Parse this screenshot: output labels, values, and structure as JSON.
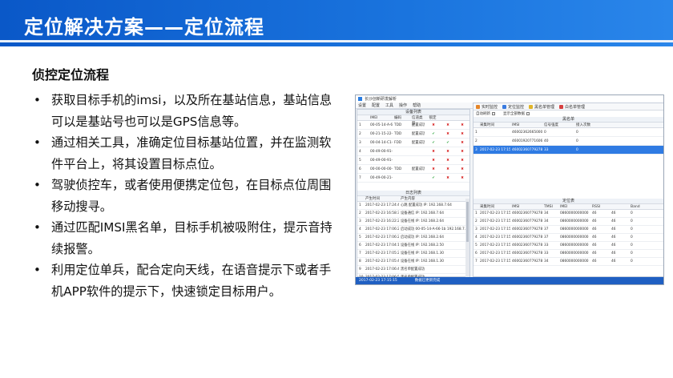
{
  "slide": {
    "title": "定位解决方案——定位流程",
    "heading": "侦控定位流程",
    "bullets": [
      "获取目标手机的imsi，以及所在基站信息，基站信息可以是基站号也可以是GPS信息等。",
      "通过相关工具，准确定位目标基站位置，并在监测软件平台上，将其设置目标点位。",
      "驾驶侦控车，或者使用便携定位包，在目标点位周围移动搜寻。",
      "通过匹配IMSI黑名单，目标手机被吸附住，提示音持续报警。",
      "利用定位单兵，配合定向天线，在语音提示下或者手机APP软件的提示下，快速锁定目标用户。"
    ],
    "bullet_symbol": "•"
  },
  "screenshot": {
    "window_title": "长沙创新研发解析",
    "menu": [
      "设置",
      "配置",
      "工具",
      "操作",
      "帮助"
    ],
    "left_section_title": "设备列表",
    "left_headers": [
      "",
      "IMEI",
      "编码",
      "信道类型",
      "锁定",
      "",
      ""
    ],
    "left_rows": [
      {
        "n": "1",
        "id": "00-05-14-A-66-1b",
        "c": "TDD",
        "t": "配置成功",
        "m": [
          "x",
          "x",
          "x"
        ]
      },
      {
        "n": "2",
        "id": "00-21-15-22-98-1C",
        "c": "TDD",
        "t": "配置成功",
        "m": [
          "ok",
          "x",
          "x"
        ]
      },
      {
        "n": "3",
        "id": "00-04-14-C1-06-59",
        "c": "FDD",
        "t": "配置成功",
        "m": [
          "ok",
          "ok",
          "x"
        ]
      },
      {
        "n": "4",
        "id": "00-49-00-91-21-60",
        "c": "",
        "t": "",
        "m": [
          "x",
          "x",
          "x"
        ]
      },
      {
        "n": "5",
        "id": "00-49-00-91-21-65",
        "c": "",
        "t": "",
        "m": [
          "x",
          "x",
          "x"
        ]
      },
      {
        "n": "6",
        "id": "00-00-00-00-1-97",
        "c": "TDD",
        "t": "配置成功",
        "m": [
          "x",
          "x",
          "x"
        ]
      },
      {
        "n": "7",
        "id": "00-49-00-21-62-91",
        "c": "",
        "t": "",
        "m": [
          "ok",
          "x",
          "x"
        ]
      }
    ],
    "log_section_title": "日志列表",
    "log_headers": [
      "",
      "产生时间",
      "产生内容"
    ],
    "log_rows": [
      {
        "n": "1",
        "time": "2017-02-23 17:24:40",
        "msg": "心跳 配置成功 IP: 192.168.7.64"
      },
      {
        "n": "2",
        "time": "2017-02-23 16:58:36",
        "msg": "设备通信 IP: 192.168.7.64"
      },
      {
        "n": "3",
        "time": "2017-02-23 16:22:27",
        "msg": "设备在线 IP: 192.168.2.64"
      },
      {
        "n": "4",
        "time": "2017-02-23 17:06:28",
        "msg": "启动成功 00-05-14-A-66-1b 192.168.7.64"
      },
      {
        "n": "5",
        "time": "2017-02-23 17:06:28",
        "msg": "启动成功 IP: 192.168.2.64"
      },
      {
        "n": "6",
        "time": "2017-02-23 17:04:16",
        "msg": "设备在线 IP: 192.168.2.50"
      },
      {
        "n": "7",
        "time": "2017-02-23 17:05:21",
        "msg": "设备在线 IP: 192.168.1.30"
      },
      {
        "n": "8",
        "time": "2017-02-23 17:05:41",
        "msg": "设备在线 IP: 192.168.1.30"
      },
      {
        "n": "9",
        "time": "2017-02-23 17:06:47",
        "msg": "黑名单配置成功"
      },
      {
        "n": "10",
        "time": "2017-02-23 17:06:53",
        "msg": "黑名单配置成功"
      }
    ],
    "tabs": [
      "实时监控",
      "定位监控",
      "黑名单管理",
      "白名单管理"
    ],
    "checkbox_labels": [
      "自动刷新",
      "显示全部数据"
    ],
    "upper_section_title": "黑名单",
    "upper_headers": [
      "",
      "采集时间",
      "IMSI",
      "信号强度",
      "接入次数"
    ],
    "upper_rows": [
      {
        "n": "1",
        "time": "",
        "imsi": "460023626650001",
        "sig": "0",
        "cnt": "0"
      },
      {
        "n": "2",
        "time": "",
        "imsi": "460019207716065",
        "sig": "40",
        "cnt": "0"
      },
      {
        "n": "3",
        "time": "2017-02-23 17:15:13",
        "imsi": "460023607792782",
        "sig": "33",
        "cnt": "0"
      }
    ],
    "lower_section_title": "定位表",
    "lower_headers": [
      "",
      "采集时间",
      "IMSI",
      "TMSI",
      "IMEI",
      "RSSI",
      "",
      "Band"
    ],
    "lower_rows": [
      {
        "n": "1",
        "time": "2017-02-23 17:15:30",
        "imsi": "460023607792782",
        "a": "34",
        "b": "0860000000000",
        "c": "46",
        "d": "0"
      },
      {
        "n": "2",
        "time": "2017-02-23 17:15:30",
        "imsi": "460023607792782",
        "a": "34",
        "b": "0860000000000",
        "c": "46",
        "d": "0"
      },
      {
        "n": "3",
        "time": "2017-02-23 17:15:40",
        "imsi": "460023607792782",
        "a": "37",
        "b": "0860000000000",
        "c": "46",
        "d": "0"
      },
      {
        "n": "4",
        "time": "2017-02-23 17:15:40",
        "imsi": "460023607792782",
        "a": "37",
        "b": "0860000000000",
        "c": "46",
        "d": "0"
      },
      {
        "n": "5",
        "time": "2017-02-23 17:15:41",
        "imsi": "460023607792782",
        "a": "33",
        "b": "0860000000000",
        "c": "46",
        "d": "0"
      },
      {
        "n": "6",
        "time": "2017-02-23 17:15:42",
        "imsi": "460023607792782",
        "a": "33",
        "b": "0860000000000",
        "c": "46",
        "d": "0"
      },
      {
        "n": "7",
        "time": "2017-02-23 17:15:43",
        "imsi": "460023607792782",
        "a": "34",
        "b": "0860000000000",
        "c": "46",
        "d": "0"
      }
    ],
    "status_time": "2017-02-23 17:15:15",
    "status_text": "数据已更新完成",
    "colors": {
      "title_bar": "#0a58c8",
      "status_bar": "#1f5fc2",
      "selected_row": "#2f7be3",
      "mark_x": "#d62020",
      "mark_ok": "#29a33a"
    }
  }
}
